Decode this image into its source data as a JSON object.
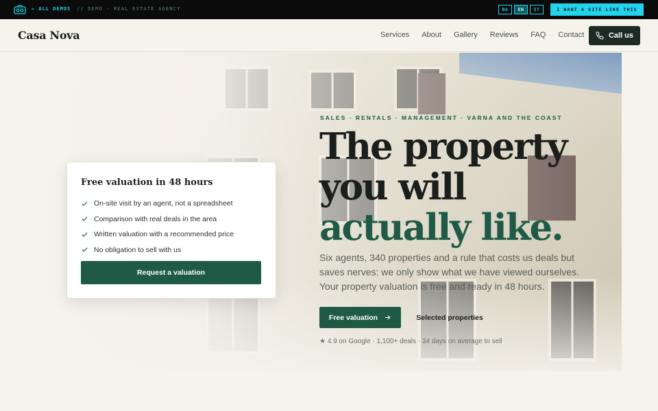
{
  "demobar": {
    "back_label": "← ALL DEMOS",
    "crumb_prefix": "// DEMO",
    "crumb_sep": " · ",
    "crumb_name": "REAL ESTATE AGENCY",
    "languages": [
      "BG",
      "EN",
      "IT"
    ],
    "active_language": "EN",
    "cta_label": "I WANT A SITE LIKE THIS",
    "accent_color": "#22d3ee"
  },
  "header": {
    "brand": "Casa Nova",
    "nav": [
      "Services",
      "About",
      "Gallery",
      "Reviews",
      "FAQ",
      "Contact"
    ],
    "call_label": "Call us",
    "call_icon": "phone-icon"
  },
  "hero": {
    "eyebrow": "SALES · RENTALS · MANAGEMENT · VARNA AND THE COAST",
    "headline_line1": "The property",
    "headline_line2": "you will",
    "headline_accent": "actually like.",
    "lead": "Six agents, 340 properties and a rule that costs us deals but saves nerves: we only show what we have viewed ourselves. Your property valuation is free and ready in 48 hours.",
    "primary_cta": "Free valuation",
    "primary_icon": "arrow-right-icon",
    "secondary_cta": "Selected properties",
    "trust_line": "★ 4.9 on Google · 1,100+ deals · 34 days on average to sell",
    "accent_color": "#1f5a46"
  },
  "valuation_card": {
    "title": "Free valuation in 48 hours",
    "items": [
      "On-site visit by an agent, not a spreadsheet",
      "Comparison with real deals in the area",
      "Written valuation with a recommended price",
      "No obligation to sell with us"
    ],
    "item_icon": "check-icon",
    "button_label": "Request a valuation"
  }
}
